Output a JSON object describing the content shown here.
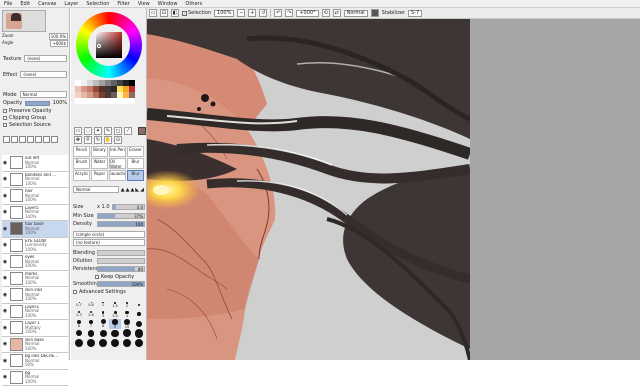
{
  "menu": [
    "File",
    "Edit",
    "Canvas",
    "Layer",
    "Selection",
    "Filter",
    "View",
    "Window",
    "Others"
  ],
  "toolbar": {
    "selection_label": "Selection",
    "zoom": "100%",
    "rotation": "+000°",
    "mode": "Normal",
    "stabilizer_label": "Stabilizer",
    "stabilizer_value": "S-7"
  },
  "navigator": {
    "zoom_label": "Zoom",
    "zoom_value": "100.0%",
    "angle_label": "Angle",
    "angle_value": "+000$"
  },
  "layer_panel": {
    "texture_label": "Texture",
    "texture_value": "(none)",
    "effect_label": "Effect",
    "effect_value": "(none)",
    "mode_label": "Mode",
    "mode_value": "Normal",
    "opacity_label": "Opacity",
    "opacity_value": "100%",
    "preserve_opacity": "Preserve Opacity",
    "clipping_group": "Clipping Group",
    "selection_source": "Selection Source"
  },
  "layers": [
    {
      "name": "out left",
      "mode": "Normal",
      "opacity": "100%",
      "thumb": "plain"
    },
    {
      "name": "bandaes and ...",
      "mode": "Normal",
      "opacity": "100%",
      "thumb": "plain"
    },
    {
      "name": "hair",
      "mode": "Normal",
      "opacity": "100%",
      "thumb": "plain"
    },
    {
      "name": "Layer5",
      "mode": "Normal",
      "opacity": "100%",
      "thumb": "plain"
    },
    {
      "name": "hair base",
      "mode": "Normal",
      "opacity": "100%",
      "thumb": "hair",
      "selected": true
    },
    {
      "name": "EYE GLOW",
      "mode": "Luminosity",
      "opacity": "100%",
      "thumb": "plain"
    },
    {
      "name": "eyes",
      "mode": "Normal",
      "opacity": "100%",
      "thumb": "plain"
    },
    {
      "name": "marks",
      "mode": "Normal",
      "opacity": "100%",
      "thumb": "plain"
    },
    {
      "name": "skin inks",
      "mode": "Normal",
      "opacity": "100%",
      "thumb": "plain"
    },
    {
      "name": "Layer3",
      "mode": "Normal",
      "opacity": "100%",
      "thumb": "plain"
    },
    {
      "name": "Layer 1",
      "mode": "Multiply",
      "opacity": "100%",
      "thumb": "plain"
    },
    {
      "name": "skin base",
      "mode": "Normal",
      "opacity": "100%",
      "thumb": "skin"
    },
    {
      "name": "bg inks DECRE...",
      "mode": "Normal",
      "opacity": "50%",
      "thumb": "plain"
    },
    {
      "name": "bg",
      "mode": "Normal",
      "opacity": "100%",
      "thumb": "plain"
    }
  ],
  "brushes": [
    {
      "label": "Pencil"
    },
    {
      "label": "Binary"
    },
    {
      "label": "Ink Pen"
    },
    {
      "label": "Eraser"
    },
    {
      "label": "Brush"
    },
    {
      "label": "Water"
    },
    {
      "label": "Oil Water"
    },
    {
      "label": "Blur"
    },
    {
      "label": "Acrylic"
    },
    {
      "label": "Paper"
    },
    {
      "label": "Gouache"
    },
    {
      "label": "Blur"
    }
  ],
  "brush_settings": {
    "mode_value": "Normal",
    "size_label": "Size",
    "size_mult": "x 1.0",
    "size_value": "4.0",
    "min_size_label": "Min Size",
    "min_size_value": "37%",
    "density_label": "Density",
    "density_value": "100",
    "shape_value": "(simple circle)",
    "texture_value": "(no texture)",
    "blending_label": "Blending",
    "dilution_label": "Dilution",
    "persistence_label": "Persistence",
    "persistence_value": "80",
    "keep_opacity": "Keep Opacity",
    "smoothing_label": "Smoothing Prs",
    "smoothing_value": "100%",
    "advanced": "Advanced Settings"
  },
  "size_presets": [
    "0.7",
    "0.8",
    "1",
    "1.5",
    "2",
    "",
    "2.3",
    "2.6",
    "3",
    "3.5",
    "4",
    "",
    "6",
    "7",
    "8",
    "9",
    "10",
    "",
    "",
    "",
    "",
    "",
    "",
    "",
    "",
    "",
    "",
    "",
    "",
    ""
  ],
  "colors": {
    "current": "#8a6c66",
    "hair": "#3d3635",
    "skin": "#d89583",
    "glow": "#ffe15a",
    "background": "#a6a6a6"
  }
}
